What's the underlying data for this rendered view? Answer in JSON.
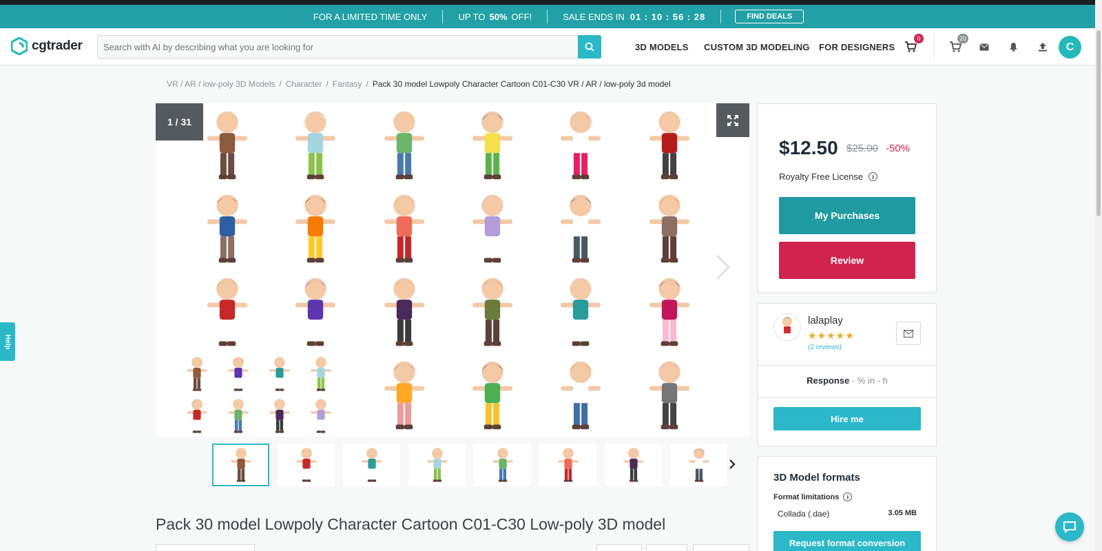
{
  "promo": {
    "limited": "FOR A LIMITED TIME ONLY",
    "up_to": "UP TO",
    "percent": "50%",
    "off": "OFF!",
    "sale_ends": "SALE ENDS IN",
    "timer": "01 : 10 : 56 : 28",
    "cta": "FIND DEALS"
  },
  "header": {
    "logo": "cgtrader",
    "search_placeholder": "Search with AI by describing what you are looking for",
    "nav": [
      "3D MODELS",
      "CUSTOM 3D MODELING",
      "FOR DESIGNERS"
    ],
    "cart_count": "0",
    "shop_count": "20",
    "avatar_letter": "C"
  },
  "breadcrumb": {
    "items": [
      "VR / AR / low-poly 3D Models",
      "Character",
      "Fantasy"
    ],
    "separator": "/",
    "current": "Pack 30 model Lowpoly Character Cartoon C01-C30 VR / AR / low-poly 3d model"
  },
  "gallery": {
    "counter": "1 / 31"
  },
  "product": {
    "title": "Pack 30 model Lowpoly Character Cartoon C01-C30 Low-poly 3D model",
    "price": "$12.50",
    "old_price": "$25.00",
    "discount": "-50%",
    "license": "Royalty Free License",
    "purchases_button": "My Purchases",
    "review_button": "Review"
  },
  "seller": {
    "name": "lalaplay",
    "stars": "★★★★★",
    "reviews": "(2 reviews)",
    "response_label": "Response",
    "response_value": " - % in - h",
    "hire_button": "Hire me"
  },
  "formats": {
    "title": "3D Model formats",
    "limitations": "Format limitations",
    "items": [
      {
        "name": "Collada (.dae)",
        "size": "3.05 MB"
      }
    ],
    "request_button": "Request format conversion"
  },
  "help_tab": "Help",
  "colors": {
    "teal": "#21a1a6",
    "accent": "#2bb8c9",
    "review": "#d0244f",
    "purchases": "#1e9aa0"
  },
  "icons": [
    "logo-icon",
    "search-icon",
    "cart-icon",
    "shop-icon",
    "mail-icon",
    "bell-icon",
    "upload-icon",
    "expand-icon",
    "chevron-right-icon",
    "info-icon",
    "chat-icon",
    "help-icon"
  ]
}
